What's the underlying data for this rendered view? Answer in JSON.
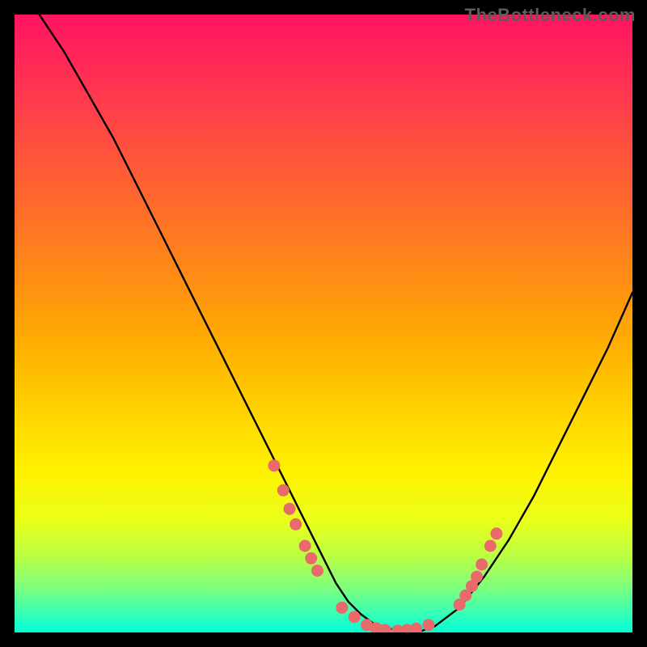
{
  "watermark": "TheBottleneck.com",
  "chart_data": {
    "type": "line",
    "title": "",
    "xlabel": "",
    "ylabel": "",
    "xlim": [
      0,
      100
    ],
    "ylim": [
      0,
      100
    ],
    "grid": false,
    "legend": false,
    "annotations": [],
    "series": [
      {
        "name": "bottleneck-curve",
        "x": [
          0,
          4,
          8,
          12,
          16,
          20,
          24,
          28,
          32,
          36,
          40,
          44,
          48,
          50,
          52,
          54,
          56,
          58,
          60,
          62,
          64,
          66,
          68,
          72,
          76,
          80,
          84,
          88,
          92,
          96,
          100
        ],
        "y": [
          null,
          100,
          94,
          87,
          80,
          72,
          64,
          56,
          48,
          40,
          32,
          24,
          16,
          12,
          8,
          5,
          3,
          1.5,
          0.8,
          0.3,
          0.1,
          0.3,
          1,
          4,
          9,
          15,
          22,
          30,
          38,
          46,
          55
        ]
      }
    ],
    "markers": {
      "name": "highlighted-points",
      "color": "#e96a6a",
      "points": [
        {
          "x": 42,
          "y": 27
        },
        {
          "x": 43.5,
          "y": 23
        },
        {
          "x": 44.5,
          "y": 20
        },
        {
          "x": 45.5,
          "y": 17.5
        },
        {
          "x": 47,
          "y": 14
        },
        {
          "x": 48,
          "y": 12
        },
        {
          "x": 49,
          "y": 10
        },
        {
          "x": 53,
          "y": 4
        },
        {
          "x": 55,
          "y": 2.5
        },
        {
          "x": 57,
          "y": 1.2
        },
        {
          "x": 58.5,
          "y": 0.7
        },
        {
          "x": 60,
          "y": 0.4
        },
        {
          "x": 62,
          "y": 0.3
        },
        {
          "x": 63.5,
          "y": 0.4
        },
        {
          "x": 65,
          "y": 0.6
        },
        {
          "x": 67,
          "y": 1.2
        },
        {
          "x": 72,
          "y": 4.5
        },
        {
          "x": 73,
          "y": 6
        },
        {
          "x": 74,
          "y": 7.5
        },
        {
          "x": 74.8,
          "y": 9
        },
        {
          "x": 75.6,
          "y": 11
        },
        {
          "x": 77,
          "y": 14
        },
        {
          "x": 78,
          "y": 16
        }
      ]
    },
    "background_gradient": {
      "stops": [
        {
          "pos": 0,
          "color": "#ff1462"
        },
        {
          "pos": 50,
          "color": "#ffb800"
        },
        {
          "pos": 80,
          "color": "#f5ff20"
        },
        {
          "pos": 100,
          "color": "#00ffd8"
        }
      ]
    }
  }
}
